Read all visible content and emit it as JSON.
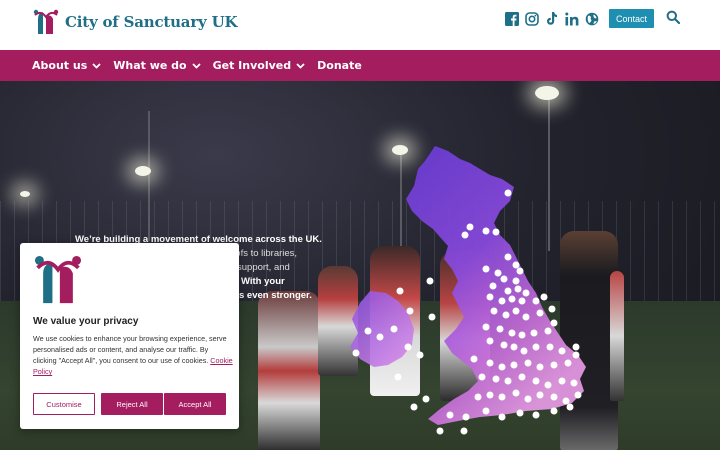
{
  "header": {
    "site_name": "City of Sanctuary UK",
    "social_icons": [
      "facebook-icon",
      "instagram-icon",
      "tiktok-icon",
      "linkedin-icon",
      "globe-icon"
    ],
    "contact_label": "Contact",
    "brand_teal": "#1f6f86",
    "brand_magenta": "#a31d5f"
  },
  "nav": {
    "items": [
      {
        "label": "About us",
        "has_dropdown": true
      },
      {
        "label": "What we do",
        "has_dropdown": true
      },
      {
        "label": "Get Involved",
        "has_dropdown": true
      },
      {
        "label": "Donate",
        "has_dropdown": false
      }
    ]
  },
  "hero": {
    "line1": "We’re building a movement of welcome across the UK.",
    "line2": "oofs to libraries,",
    "line3": "support, and",
    "line4": "With your",
    "line5": "s even stronger."
  },
  "cookie": {
    "title": "We value your privacy",
    "body": "We use cookies to enhance your browsing experience, serve personalised ads or content, and analyse our traffic. By clicking \"Accept All\", you consent to our use of cookies.",
    "link": "Cookie Policy",
    "customise_label": "Customise",
    "reject_label": "Reject All",
    "accept_label": "Accept All"
  }
}
